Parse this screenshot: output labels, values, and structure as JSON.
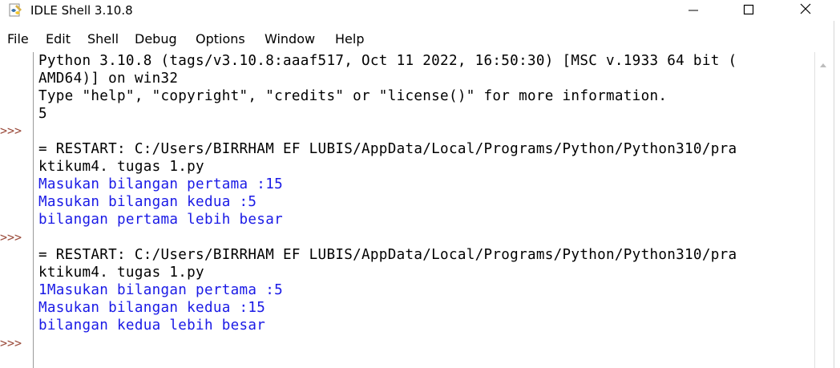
{
  "window": {
    "title": "IDLE Shell 3.10.8",
    "icon": "python-idle-icon",
    "controls": [
      "minimize",
      "maximize",
      "close"
    ]
  },
  "menu": [
    "File",
    "Edit",
    "Shell",
    "Debug",
    "Options",
    "Window",
    "Help"
  ],
  "prompts": [
    ">>>",
    ">>>",
    ">>>"
  ],
  "lines": [
    {
      "text": "Python 3.10.8 (tags/v3.10.8:aaaf517, Oct 11 2022, 16:50:30) [MSC v.1933 64 bit (",
      "color": "black"
    },
    {
      "text": "AMD64)] on win32",
      "color": "black"
    },
    {
      "text": "Type \"help\", \"copyright\", \"credits\" or \"license()\" for more information.",
      "color": "black"
    },
    {
      "text": "5",
      "color": "black"
    },
    {
      "text": "",
      "color": "black"
    },
    {
      "text": "= RESTART: C:/Users/BIRRHAM EF LUBIS/AppData/Local/Programs/Python/Python310/pra",
      "color": "black"
    },
    {
      "text": "ktikum4. tugas 1.py",
      "color": "black"
    },
    {
      "text": "Masukan bilangan pertama :15",
      "color": "blue"
    },
    {
      "text": "Masukan bilangan kedua :5",
      "color": "blue"
    },
    {
      "text": "bilangan pertama lebih besar",
      "color": "blue"
    },
    {
      "text": "",
      "color": "black"
    },
    {
      "text": "= RESTART: C:/Users/BIRRHAM EF LUBIS/AppData/Local/Programs/Python/Python310/pra",
      "color": "black"
    },
    {
      "text": "ktikum4. tugas 1.py",
      "color": "black"
    },
    {
      "text": "1Masukan bilangan pertama :5",
      "color": "blue"
    },
    {
      "text": "Masukan bilangan kedua :15",
      "color": "blue"
    },
    {
      "text": "bilangan kedua lebih besar",
      "color": "blue"
    },
    {
      "text": "",
      "color": "black"
    }
  ],
  "colors": {
    "prompt": "#9a4a3a",
    "output_blue": "#1a1ae6",
    "text_black": "#000000"
  }
}
